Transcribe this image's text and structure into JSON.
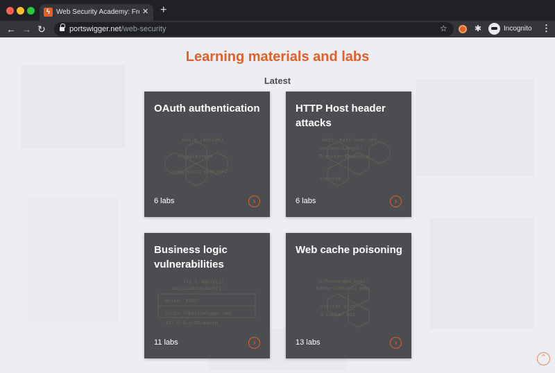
{
  "browser": {
    "tab_title": "Web Security Academy: Free Online Training from PortSwigger",
    "tab_favicon": "ϟ",
    "tab_close": "✕",
    "new_tab": "+",
    "url_host": "portswigger.net",
    "url_path": "/web-security",
    "profile_label": "Incognito",
    "icons": {
      "back": "←",
      "forward": "→",
      "reload": "↻",
      "star": "☆",
      "puzzle": "✱",
      "menu": "⋮"
    }
  },
  "page": {
    "heading": "Learning materials and labs",
    "subheading": "Latest",
    "cards": [
      {
        "title": "OAuth authentication",
        "count": "6 labs",
        "arrow": "›"
      },
      {
        "title": "HTTP Host header attacks",
        "count": "6 labs",
        "arrow": "›"
      },
      {
        "title": "Business logic vulnerabilities",
        "count": "11 labs",
        "arrow": "›"
      },
      {
        "title": "Web cache poisoning",
        "count": "13 labs",
        "arrow": "›"
      }
    ],
    "scroll_top": "⌃"
  },
  "colors": {
    "accent": "#e2602a",
    "card_bg": "#4b4d50",
    "page_bg": "#eceef1",
    "chrome_dark": "#202124",
    "chrome_toolbar": "#35363a"
  }
}
